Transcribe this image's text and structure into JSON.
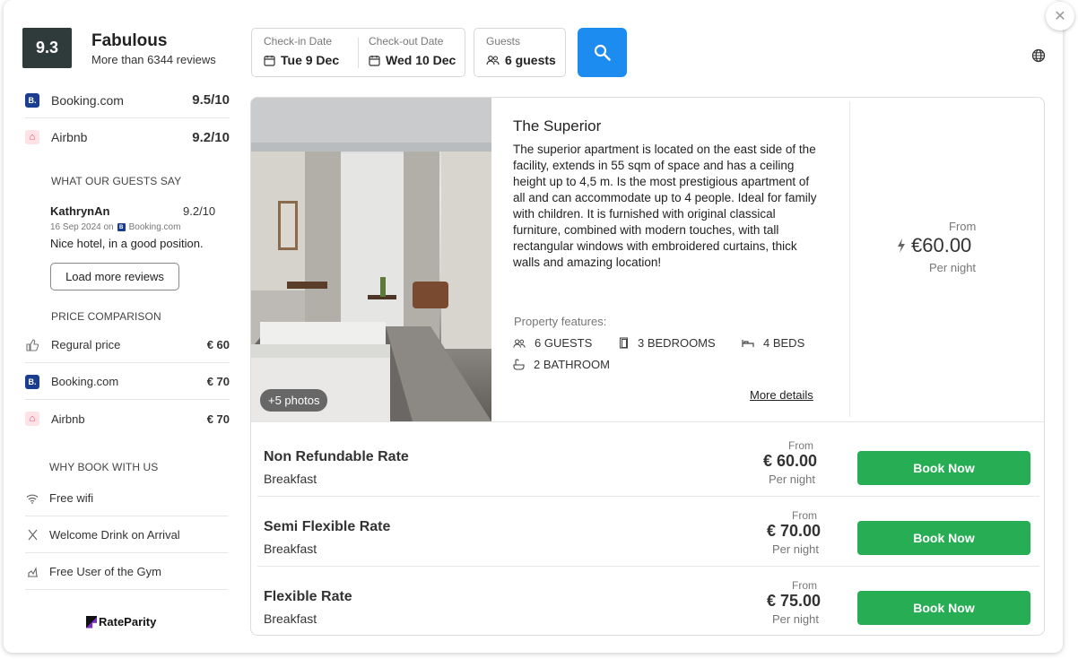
{
  "rating": {
    "score": "9.3",
    "title": "Fabulous",
    "subtitle": "More than 6344 reviews"
  },
  "sources": [
    {
      "name": "Booking.com",
      "score": "9.5/10",
      "logo_text": "B."
    },
    {
      "name": "Airbnb",
      "score": "9.2/10",
      "logo_text": "⌂"
    }
  ],
  "reviews": {
    "section_title": "WHAT OUR GUESTS SAY",
    "author": "KathrynAn",
    "score": "9.2/10",
    "date": "16 Sep 2024 on",
    "source": "Booking.com",
    "text": "Nice hotel, in a good position.",
    "load_more_label": "Load more reviews"
  },
  "price_comparison": {
    "section_title": "PRICE COMPARISON",
    "items": [
      {
        "name": "Regural price",
        "value": "€ 60",
        "icon": "thumbs-up-icon"
      },
      {
        "name": "Booking.com",
        "value": "€ 70",
        "icon": "booking-logo"
      },
      {
        "name": "Airbnb",
        "value": "€ 70",
        "icon": "airbnb-logo"
      }
    ]
  },
  "why_book": {
    "section_title": "WHY BOOK WITH US",
    "items": [
      {
        "name": "Free wifi",
        "icon": "wifi-icon"
      },
      {
        "name": "Welcome Drink on Arrival",
        "icon": "cutlery-icon"
      },
      {
        "name": "Free User of the Gym",
        "icon": "gym-icon"
      }
    ]
  },
  "brand": {
    "name": "RateParity"
  },
  "search": {
    "checkin_label": "Check-in Date",
    "checkin_value": "Tue 9 Dec",
    "checkout_label": "Check-out Date",
    "checkout_value": "Wed 10 Dec",
    "guests_label": "Guests",
    "guests_value": "6 guests"
  },
  "room": {
    "photos_badge": "+5  photos",
    "title": "The Superior",
    "description": "The superior apartment is located on the east side of the facility, extends in 55 sqm of space and has a ceiling height up to 4,5 m. Is the most prestigious apartment of all and can accommodate up to 4 people. Ideal for family with children. It is furnished with original classical furniture, combined with modern touches, with tall rectangular windows with embroidered curtains, thick walls and amazing location!",
    "features_title": "Property features:",
    "features": [
      {
        "label": "6 GUESTS",
        "icon": "guests-icon"
      },
      {
        "label": "3 BEDROOMS",
        "icon": "door-icon"
      },
      {
        "label": "4 BEDS",
        "icon": "bed-icon"
      },
      {
        "label": "2 BATHROOM",
        "icon": "bath-icon"
      }
    ],
    "more_details": "More details",
    "from_label": "From",
    "from_price": "€60.00",
    "per_night": "Per night"
  },
  "rates": [
    {
      "name": "Non Refundable Rate",
      "sub": "Breakfast",
      "from": "From",
      "price": "€ 60.00",
      "per_night": "Per night",
      "button": "Book Now"
    },
    {
      "name": "Semi Flexible Rate",
      "sub": "Breakfast",
      "from": "From",
      "price": "€ 70.00",
      "per_night": "Per night",
      "button": "Book Now"
    },
    {
      "name": "Flexible Rate",
      "sub": "Breakfast",
      "from": "From",
      "price": "€ 75.00",
      "per_night": "Per night",
      "button": "Book Now"
    }
  ],
  "colors": {
    "accent": "#1c8cf0",
    "book": "#27ae54",
    "score_bg": "#2f3b3b"
  }
}
